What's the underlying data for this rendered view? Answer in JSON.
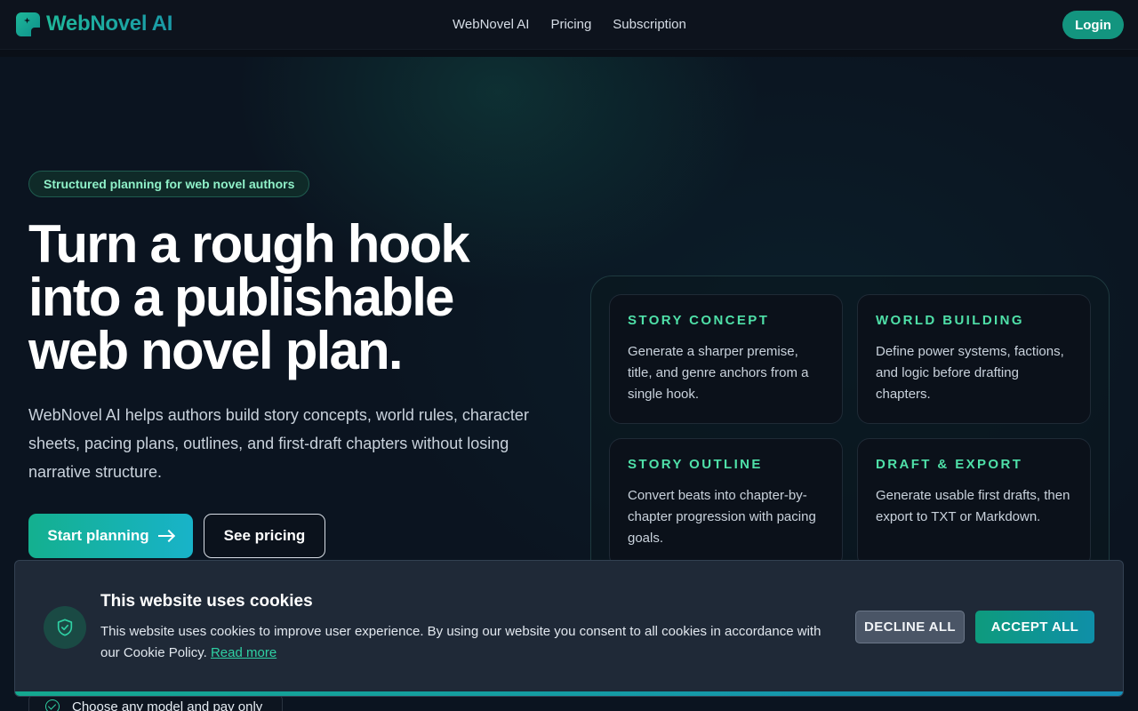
{
  "nav": {
    "brand": "WebNovel AI",
    "links": [
      "WebNovel AI",
      "Pricing",
      "Subscription"
    ],
    "login_label": "Login"
  },
  "hero": {
    "badge": "Structured planning for web novel authors",
    "title_lines": [
      "Turn a rough hook",
      "into a publishable",
      "web novel plan."
    ],
    "description": "WebNovel AI helps authors build story concepts, world rules, character sheets, pacing plans, outlines, and first-draft chapters without losing narrative structure.",
    "primary_cta": "Start planning",
    "secondary_cta": "See pricing",
    "feature_row": "Choose any model and pay only"
  },
  "features": [
    {
      "title": "STORY CONCEPT",
      "text": "Generate a sharper premise, title, and genre anchors from a single hook."
    },
    {
      "title": "WORLD BUILDING",
      "text": "Define power systems, factions, and logic before drafting chapters."
    },
    {
      "title": "STORY OUTLINE",
      "text": "Convert beats into chapter-by-chapter progression with pacing goals."
    },
    {
      "title": "DRAFT & EXPORT",
      "text": "Generate usable first drafts, then export to TXT or Markdown."
    }
  ],
  "cookie": {
    "title": "This website uses cookies",
    "text": "This website uses cookies to improve user experience. By using our website you consent to all cookies in accordance with our Cookie Policy.",
    "link_label": "Read more",
    "decline_label": "DECLINE ALL",
    "accept_label": "ACCEPT ALL"
  },
  "colors": {
    "accent": "#14b08f",
    "accent_text": "#4fe0a8",
    "background": "#0b1220",
    "banner": "#1f2937"
  },
  "icons": {
    "logo": "bookmark-sparkle-icon",
    "cta_arrow": "arrow-right-icon",
    "cookie": "shield-check-icon",
    "feature_check": "check-circle-icon"
  }
}
